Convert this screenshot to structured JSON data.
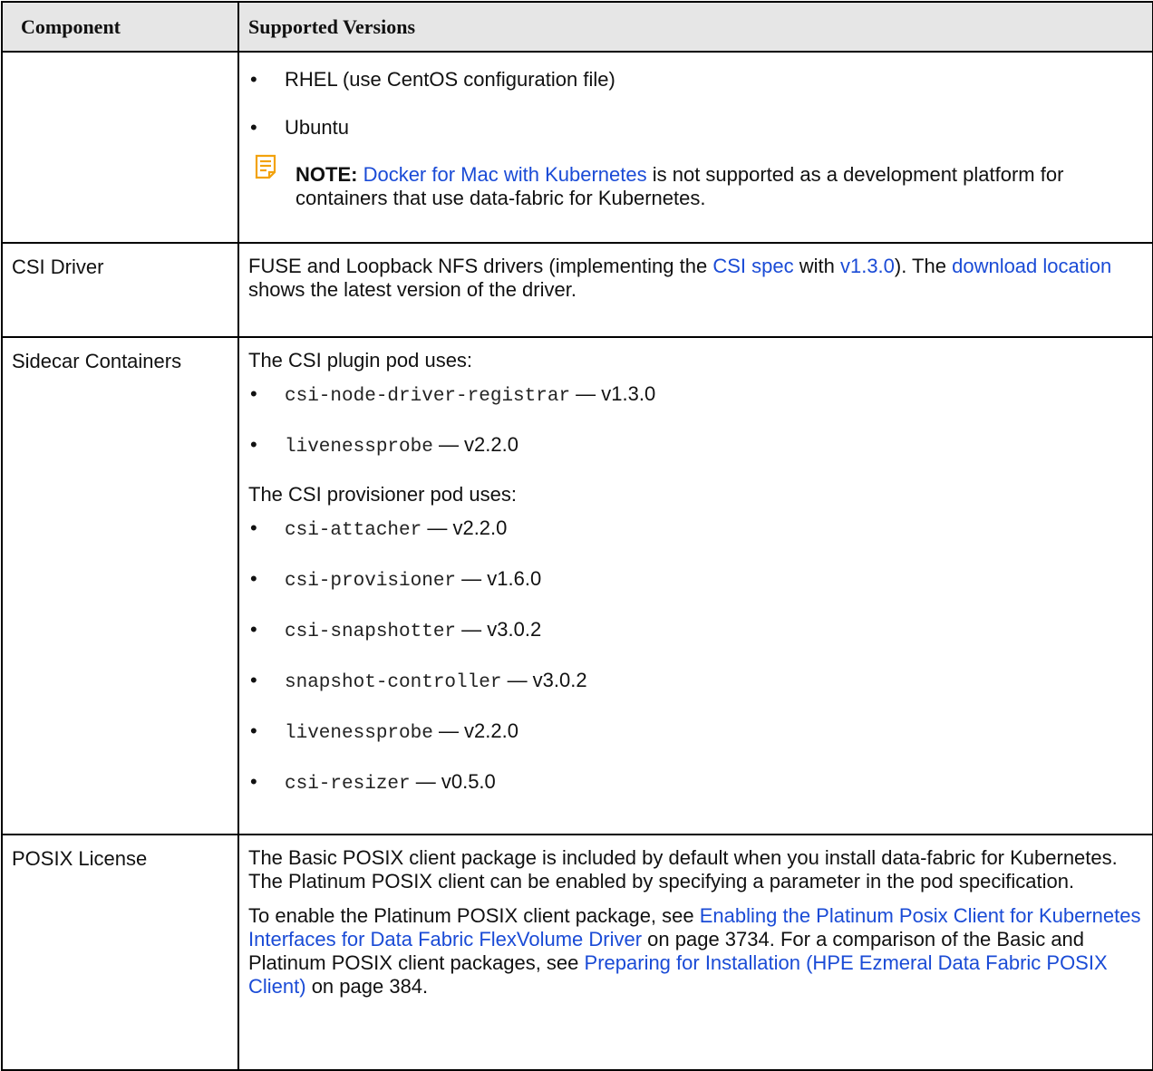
{
  "table": {
    "header": {
      "component": "Component",
      "versions": "Supported Versions"
    },
    "os_row": {
      "items": [
        "RHEL (use CentOS configuration file)",
        "Ubuntu"
      ],
      "note": {
        "label": "NOTE:",
        "link": "Docker for Mac with Kubernetes",
        "text": " is not supported as a development platform for containers that use data-fabric for Kubernetes."
      }
    },
    "csi_row": {
      "component": "CSI Driver",
      "text_1": "FUSE and Loopback NFS drivers (implementing the ",
      "link_spec": "CSI spec",
      "text_2": " with ",
      "link_version": "v1.3.0",
      "text_3": "). The ",
      "link_download": "download location",
      "text_4": " shows the latest version of the driver."
    },
    "sidecar_row": {
      "component": "Sidecar Containers",
      "plugin_intro": "The CSI plugin pod uses:",
      "plugin_items": [
        {
          "name": "csi-node-driver-registrar",
          "version": " — v1.3.0"
        },
        {
          "name": "livenessprobe",
          "version": " — v2.2.0"
        }
      ],
      "provisioner_intro": "The CSI provisioner pod uses:",
      "provisioner_items": [
        {
          "name": "csi-attacher",
          "version": " — v2.2.0"
        },
        {
          "name": "csi-provisioner",
          "version": " — v1.6.0"
        },
        {
          "name": "csi-snapshotter",
          "version": " — v3.0.2"
        },
        {
          "name": "snapshot-controller",
          "version": " — v3.0.2"
        },
        {
          "name": "livenessprobe",
          "version": " — v2.2.0"
        },
        {
          "name": "csi-resizer",
          "version": " — v0.5.0"
        }
      ]
    },
    "posix_row": {
      "component": "POSIX License",
      "para_1": "The Basic POSIX client package is included by default when you install data-fabric for Kubernetes. The Platinum POSIX client can be enabled by specifying a parameter in the pod specification.",
      "para_2_a": "To enable the Platinum POSIX client package, see ",
      "para_2_link1": "Enabling the Platinum Posix Client for Kubernetes Interfaces for Data Fabric FlexVolume Driver",
      "para_2_b": " on page 3734. For a comparison of the Basic and Platinum POSIX client packages, see ",
      "para_2_link2": "Preparing for Installation (HPE Ezmeral Data Fabric POSIX Client)",
      "para_2_c": " on page 384."
    }
  },
  "colors": {
    "link": "#1a4bd6",
    "header_bg": "#e6e6e6",
    "note_icon": "#f2a20c"
  },
  "icons": {
    "note": "note-icon"
  }
}
